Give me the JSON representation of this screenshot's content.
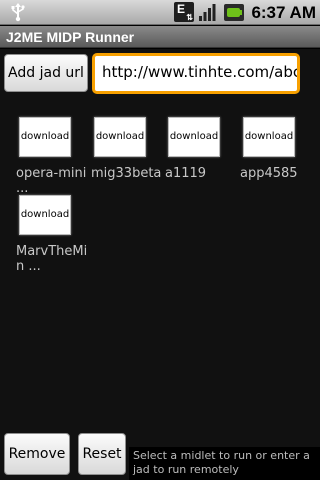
{
  "status_bar": {
    "time": "6:37 AM",
    "network_label": "E",
    "icons": [
      "usb-icon",
      "edge-icon",
      "signal-icon",
      "battery-icon"
    ]
  },
  "app": {
    "title": "J2ME MIDP Runner"
  },
  "toolbar": {
    "add_label": "Add jad url",
    "url_value": "http://www.tinhte.com/abc"
  },
  "midlets": [
    {
      "icon_text": "download",
      "label": "opera-mini ..."
    },
    {
      "icon_text": "download",
      "label": "mig33beta"
    },
    {
      "icon_text": "download",
      "label": "a1119"
    },
    {
      "icon_text": "download",
      "label": "app4585"
    },
    {
      "icon_text": "download",
      "label": "MarvTheMin ..."
    }
  ],
  "footer": {
    "remove_label": "Remove",
    "reset_label": "Reset",
    "status": "Select a midlet to run or enter a jad to run remotely"
  },
  "colors": {
    "input_focus": "#f7a000",
    "title_bar": "#6e6e6e"
  }
}
